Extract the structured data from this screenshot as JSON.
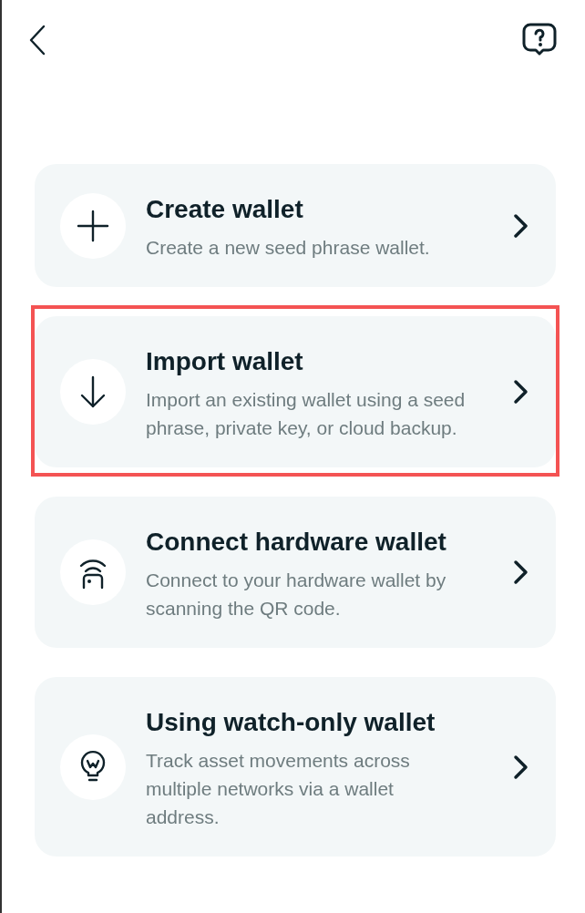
{
  "options": [
    {
      "kind": "create",
      "title": "Create wallet",
      "description": "Create a new seed phrase wallet.",
      "highlighted": false
    },
    {
      "kind": "import",
      "title": "Import wallet",
      "description": "Import an existing wallet using a seed phrase, private key, or cloud backup.",
      "highlighted": true
    },
    {
      "kind": "hardware",
      "title": "Connect hardware wallet",
      "description": "Connect to your hardware wallet by scanning the QR code.",
      "highlighted": false
    },
    {
      "kind": "watch",
      "title": "Using watch-only wallet",
      "description": "Track asset movements across multiple networks via a wallet address.",
      "highlighted": false
    }
  ]
}
